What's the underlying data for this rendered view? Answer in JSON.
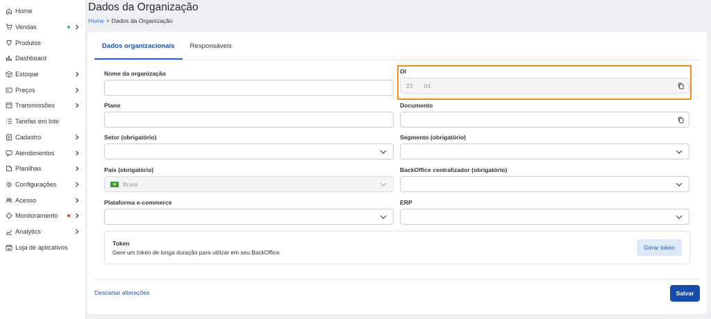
{
  "sidebar": {
    "items": [
      {
        "label": "Home",
        "icon": "home-icon",
        "chevron": false,
        "dot": null
      },
      {
        "label": "Vendas",
        "icon": "cart-icon",
        "chevron": true,
        "dot": "#3cb371"
      },
      {
        "label": "Produtos",
        "icon": "tag-icon",
        "chevron": false,
        "dot": null
      },
      {
        "label": "Dashboard",
        "icon": "bar-chart-icon",
        "chevron": false,
        "dot": null
      },
      {
        "label": "Estoque",
        "icon": "box-icon",
        "chevron": true,
        "dot": null
      },
      {
        "label": "Preços",
        "icon": "price-tag-icon",
        "chevron": true,
        "dot": null
      },
      {
        "label": "Transmissões",
        "icon": "transmission-icon",
        "chevron": true,
        "dot": null
      },
      {
        "label": "Tarefas em lote",
        "icon": "list-icon",
        "chevron": false,
        "dot": null
      },
      {
        "label": "Cadastro",
        "icon": "register-icon",
        "chevron": true,
        "dot": null
      },
      {
        "label": "Atendimentos",
        "icon": "chat-icon",
        "chevron": true,
        "dot": null
      },
      {
        "label": "Planilhas",
        "icon": "spreadsheet-icon",
        "chevron": true,
        "dot": null
      },
      {
        "label": "Configurações",
        "icon": "gear-icon",
        "chevron": true,
        "dot": null
      },
      {
        "label": "Acesso",
        "icon": "users-icon",
        "chevron": true,
        "dot": null
      },
      {
        "label": "Monitoramento",
        "icon": "diamond-icon",
        "chevron": true,
        "dot": "#e53935"
      },
      {
        "label": "Analytics",
        "icon": "analytics-icon",
        "chevron": true,
        "dot": null
      },
      {
        "label": "Loja de aplicativos",
        "icon": "store-icon",
        "chevron": false,
        "dot": null
      }
    ]
  },
  "header": {
    "title": "Dados da Organização",
    "breadcrumb": {
      "home": "Home",
      "separator": ">",
      "current": "Dados da Organização"
    }
  },
  "tabs": [
    {
      "label": "Dados organizacionais",
      "active": true
    },
    {
      "label": "Responsáveis",
      "active": false
    }
  ],
  "fields": {
    "org_name": {
      "label": "Nome da organização",
      "value": ""
    },
    "oi": {
      "label": "OI",
      "value_part1": "22",
      "value_part2": "04."
    },
    "plano": {
      "label": "Plano",
      "value": ""
    },
    "documento": {
      "label": "Documento",
      "value": ""
    },
    "setor": {
      "label": "Setor (obrigatório)",
      "value": ""
    },
    "segmento": {
      "label": "Segmento (obrigatório)",
      "value": ""
    },
    "pais": {
      "label": "País (obrigatório)",
      "value": "Brasil"
    },
    "backoffice": {
      "label": "BackOffice centralizador (obrigatório)",
      "value": ""
    },
    "plataforma": {
      "label": "Plataforma e-commerce",
      "value": ""
    },
    "erp": {
      "label": "ERP",
      "value": ""
    }
  },
  "token": {
    "title": "Token",
    "description": "Gere um token de longa duração para utilizar em seu BackOffice",
    "button": "Gerar token"
  },
  "footer": {
    "discard": "Descartar alterações",
    "save": "Salvar"
  },
  "colors": {
    "primary": "#164da8",
    "highlight": "#f08a1c"
  }
}
